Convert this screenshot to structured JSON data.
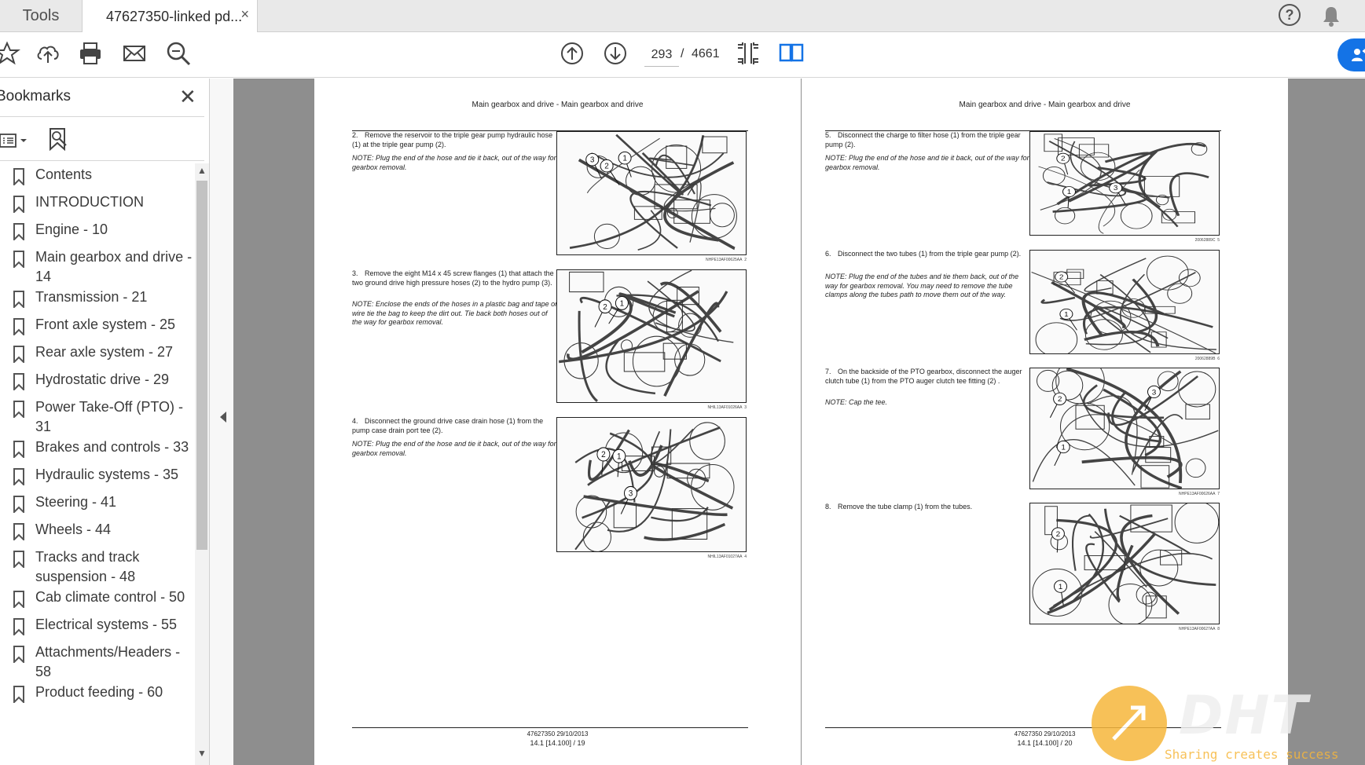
{
  "tabs": {
    "tools_label": "Tools",
    "doc_label": "47627350-linked pd...",
    "close_glyph": "×"
  },
  "top_icons": [
    "help-icon",
    "bell-icon"
  ],
  "help_glyph": "?",
  "toolbar": {
    "icons": [
      "star-icon",
      "upload-icon",
      "print-icon",
      "mail-icon",
      "zoom-icon",
      "arrow-up-icon",
      "arrow-down-icon",
      "page-fit-icon",
      "two-page-icon",
      "share-icon"
    ],
    "current_page": "293",
    "separator": "/",
    "total_pages": "4661"
  },
  "sidebar": {
    "title": "Bookmarks",
    "close_glyph": "✕",
    "items": [
      {
        "label": "Contents"
      },
      {
        "label": "INTRODUCTION"
      },
      {
        "label": "Engine - 10"
      },
      {
        "label": "Main gearbox and drive - 14"
      },
      {
        "label": "Transmission - 21"
      },
      {
        "label": "Front axle system - 25"
      },
      {
        "label": "Rear axle system - 27"
      },
      {
        "label": "Hydrostatic drive - 29"
      },
      {
        "label": "Power Take-Off (PTO) - 31"
      },
      {
        "label": "Brakes and controls - 33"
      },
      {
        "label": "Hydraulic systems - 35"
      },
      {
        "label": "Steering - 41"
      },
      {
        "label": "Wheels - 44"
      },
      {
        "label": "Tracks and track suspension - 48"
      },
      {
        "label": "Cab climate control - 50"
      },
      {
        "label": "Electrical systems - 55"
      },
      {
        "label": "Attachments/Headers - 58"
      },
      {
        "label": "Product feeding - 60"
      }
    ]
  },
  "pages": [
    {
      "header": "Main gearbox and drive - Main gearbox and drive",
      "steps": [
        {
          "num": "2.",
          "text": "Remove the reservoir to the triple gear pump hydraulic hose (1) at the triple gear pump (2).",
          "note": "NOTE: Plug the end of the hose and tie it back, out of the way for gearbox removal.",
          "fig_code": "NHPE13AF00625AA",
          "fig_num": "2"
        },
        {
          "num": "3.",
          "text": "Remove the eight M14 x 45 screw flanges (1) that attach the two ground drive high pressure hoses (2) to the hydro pump (3).",
          "note": "NOTE: Enclose the ends of the hoses in a plastic bag and tape or wire tie the bag to keep the dirt out. Tie back both hoses out of the way for gearbox removal.",
          "fig_code": "NHIL13AF01026AA",
          "fig_num": "3"
        },
        {
          "num": "4.",
          "text": "Disconnect the ground drive case drain hose (1) from the pump case drain port tee (2).",
          "note": "NOTE: Plug the end of the hose and tie it back, out of the way for gearbox removal.",
          "fig_code": "NHIL13AF01027AA",
          "fig_num": "4"
        }
      ],
      "footer_code": "47627350 29/10/2013",
      "footer_page": "14.1 [14.100] / 19"
    },
    {
      "header": "Main gearbox and drive - Main gearbox and drive",
      "steps": [
        {
          "num": "5.",
          "text": "Disconnect the charge to filter hose (1) from the triple gear pump (2).",
          "note": "NOTE: Plug the end of the hose and tie it back, out of the way for gearbox removal.",
          "fig_code": "20062889C",
          "fig_num": "5"
        },
        {
          "num": "6.",
          "text": "Disconnect the two tubes (1) from the triple gear pump (2).",
          "note": "NOTE: Plug the end of the tubes and tie them back, out of the way for gearbox removal. You may need to remove the tube clamps along the tubes path to move them out of the way.",
          "fig_code": "20062889B",
          "fig_num": "6"
        },
        {
          "num": "7.",
          "text": "On the backside of the PTO gearbox, disconnect the auger clutch tube (1) from the PTO auger clutch tee fitting (2) .",
          "note": "NOTE: Cap the tee.",
          "fig_code": "NHPE13AF00626AA",
          "fig_num": "7"
        },
        {
          "num": "8.",
          "text": "Remove the tube clamp (1) from the tubes.",
          "note": "",
          "fig_code": "NHPE13AF00627AA",
          "fig_num": "8"
        }
      ],
      "footer_code": "47627350 29/10/2013",
      "footer_page": "14.1 [14.100] / 20"
    }
  ],
  "watermark": {
    "logo": "DHT",
    "tagline": "Sharing creates success"
  },
  "colors": {
    "accent": "#1473e6",
    "watermark": "#f6b73c",
    "doc_bg": "#8e8e8e"
  }
}
